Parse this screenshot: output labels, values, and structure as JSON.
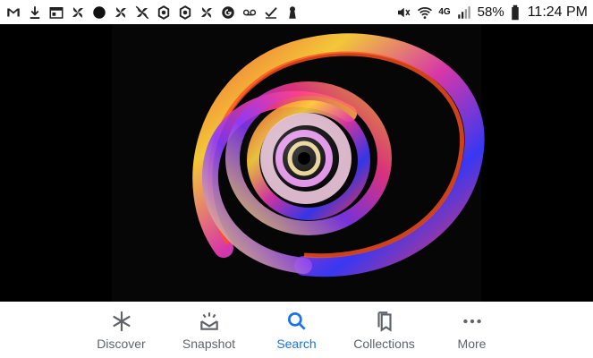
{
  "status_bar": {
    "left_icons": [
      "gmail-icon",
      "download-icon",
      "calendar-icon",
      "pinwheel-icon",
      "dot-icon",
      "pinwheel-icon",
      "crossed-pinwheel-icon",
      "app-icon",
      "app-icon",
      "pinwheel-icon",
      "google-icon",
      "voicemail-icon",
      "check-icon",
      "keyhole-icon"
    ],
    "battery_percent": "58%",
    "time": "11:24 PM",
    "network": "4G"
  },
  "media": {
    "description_icon": "spiral-image-icon"
  },
  "bottom_nav": {
    "items": [
      {
        "label": "Discover",
        "icon": "asterisk-icon",
        "active": false
      },
      {
        "label": "Snapshot",
        "icon": "snapshot-icon",
        "active": false
      },
      {
        "label": "Search",
        "icon": "search-icon",
        "active": true
      },
      {
        "label": "Collections",
        "icon": "collections-icon",
        "active": false
      },
      {
        "label": "More",
        "icon": "more-icon",
        "active": false
      }
    ]
  },
  "colors": {
    "accent": "#1a73e8",
    "inactive": "#5f6368"
  }
}
